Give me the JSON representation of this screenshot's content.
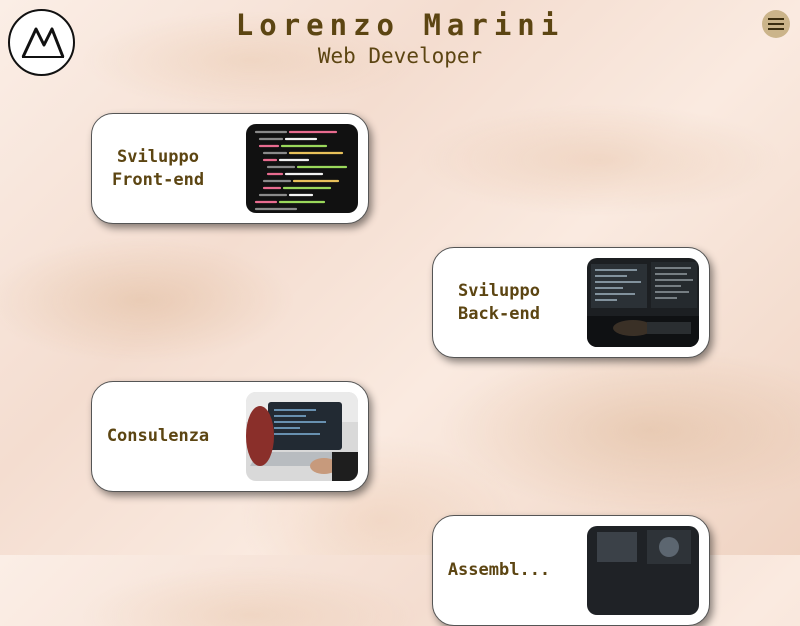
{
  "header": {
    "name": "Lorenzo Marini",
    "role": "Web Developer",
    "logo_text": "M"
  },
  "menu": {
    "icon": "hamburger-icon"
  },
  "cards": [
    {
      "label": "Sviluppo\nFront-end",
      "image": "code-screen-image"
    },
    {
      "label": "Sviluppo\nBack-end",
      "image": "developer-desk-image"
    },
    {
      "label": "Consulenza",
      "image": "laptop-typing-image"
    },
    {
      "label": "Assembl...",
      "image": "hardware-image"
    }
  ],
  "colors": {
    "accent": "#5c4512",
    "menu_bg": "#cbb48a"
  }
}
